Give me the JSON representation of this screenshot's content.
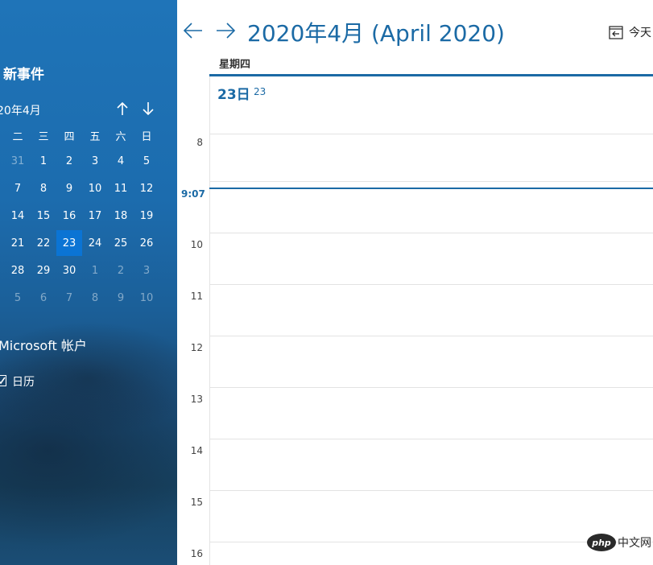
{
  "sidebar": {
    "new_event_label": "新事件",
    "mini_month_label": "20年4月",
    "weekdays": [
      "二",
      "三",
      "四",
      "五",
      "六",
      "日"
    ],
    "weeks": [
      [
        "31",
        "1",
        "2",
        "3",
        "4",
        "5"
      ],
      [
        "7",
        "8",
        "9",
        "10",
        "11",
        "12"
      ],
      [
        "14",
        "15",
        "16",
        "17",
        "18",
        "19"
      ],
      [
        "21",
        "22",
        "23",
        "24",
        "25",
        "26"
      ],
      [
        "28",
        "29",
        "30",
        "1",
        "2",
        "3"
      ],
      [
        "5",
        "6",
        "7",
        "8",
        "9",
        "10"
      ]
    ],
    "account_label": "Microsoft 帐户",
    "calendar_label": "日历",
    "calendar_checked": true
  },
  "header": {
    "title": "2020年4月 (April 2020)",
    "today_label": "今天"
  },
  "day_view": {
    "weekday_label": "星期四",
    "day_big": "23日",
    "day_small": "23",
    "now_time": "9:07",
    "hours": [
      "8",
      "10",
      "11",
      "12",
      "13",
      "14",
      "15",
      "16"
    ]
  },
  "watermark": {
    "left_text": "php",
    "right_text": "中文网"
  },
  "colors": {
    "accent": "#1b6aa5",
    "today_highlight": "#0b74d4",
    "sidebar_bg": "#1c6cae"
  }
}
